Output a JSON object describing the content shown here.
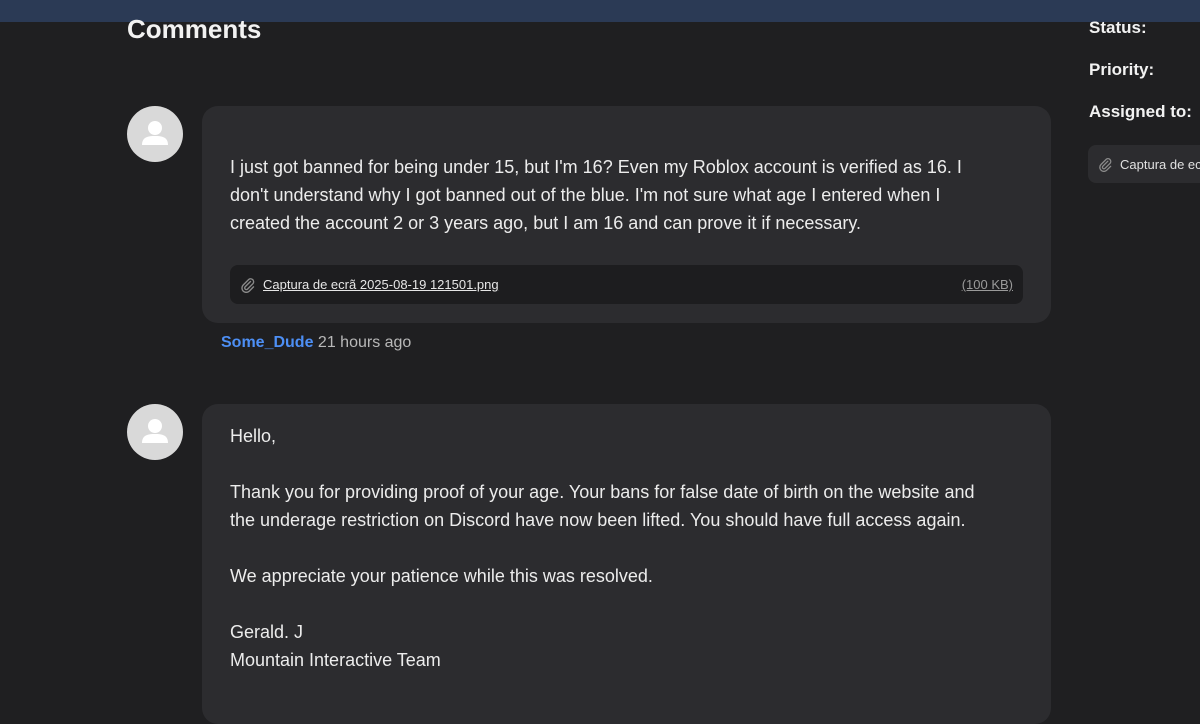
{
  "header": {
    "title": "Comments"
  },
  "comments": [
    {
      "body": "I just got banned for being under 15, but I'm 16? Even my Roblox account is verified as 16. I don't understand why I got banned out of the blue. I'm not sure what age I entered when created the account 2 or 3 years ago, but I am 16 and can prove it if necessary.",
      "lines": [
        "I just got banned for being under 15, but I'm 16? Even my Roblox account is verified as 16. I",
        "don't understand why I got banned out of the blue. I'm not sure what age I entered when I",
        "created the account 2 or 3 years ago, but I am 16 and can prove it if necessary."
      ],
      "attachment": {
        "filename": "Captura de ecrã 2025-08-19 121501.png",
        "size": "(100 KB)",
        "icon": "paperclip-icon"
      },
      "author": "Some_Dude",
      "time": "21 hours ago"
    },
    {
      "greeting": "Hello,",
      "paragraph1_line1": "Thank you for providing proof of your age. Your bans for false date of birth on the website and",
      "paragraph1_line2": "the underage restriction on Discord have now been lifted. You should have full access again.",
      "paragraph2": "We appreciate your patience while this was resolved.",
      "signature_name": "Gerald. J",
      "signature_team": "Mountain Interactive Team"
    }
  ],
  "sidebar": {
    "status_label": "Status:",
    "priority_label": "Priority:",
    "assigned_label": "Assigned to:",
    "attachment_label": "Captura de ec",
    "attachment_icon": "paperclip-icon"
  },
  "colors": {
    "background": "#1f1f21",
    "topbar": "#2b3a55",
    "bubble": "#2c2c2f",
    "author_link": "#4d8ff5"
  }
}
